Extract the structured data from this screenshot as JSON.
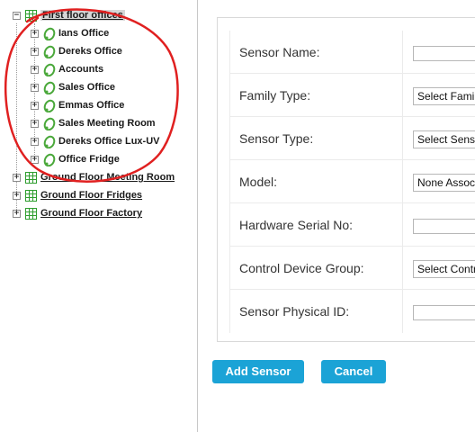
{
  "tree": {
    "root": {
      "label": "First floor offices",
      "expanded": true,
      "toggle": "−"
    },
    "children": [
      {
        "label": "Ians Office",
        "toggle": "+"
      },
      {
        "label": "Dereks Office",
        "toggle": "+"
      },
      {
        "label": "Accounts",
        "toggle": "+"
      },
      {
        "label": "Sales Office",
        "toggle": "+"
      },
      {
        "label": "Emmas Office",
        "toggle": "+"
      },
      {
        "label": "Sales Meeting Room",
        "toggle": "+"
      },
      {
        "label": "Dereks Office Lux-UV",
        "toggle": "+"
      },
      {
        "label": "Office Fridge",
        "toggle": "+"
      }
    ],
    "siblings": [
      {
        "label": "Ground Floor Meeting Room",
        "toggle": "+"
      },
      {
        "label": "Ground Floor Fridges",
        "toggle": "+"
      },
      {
        "label": "Ground Floor Factory",
        "toggle": "+"
      }
    ]
  },
  "form": {
    "sensor_name": {
      "label": "Sensor Name:",
      "value": ""
    },
    "family_type": {
      "label": "Family Type:",
      "selected": "Select Family Type"
    },
    "sensor_type": {
      "label": "Sensor Type:",
      "selected": "Select Sensor Type"
    },
    "model": {
      "label": "Model:",
      "selected": "None Associated"
    },
    "hardware_serial": {
      "label": "Hardware Serial No:",
      "value": ""
    },
    "control_device_group": {
      "label": "Control Device Group:",
      "selected": "Select Control Device Group"
    },
    "sensor_physical_id": {
      "label": "Sensor Physical ID:",
      "value": ""
    }
  },
  "buttons": {
    "add_sensor": "Add Sensor",
    "cancel": "Cancel"
  },
  "colors": {
    "accent": "#1ba3d6",
    "grid_icon": "#2f9e2f",
    "leaf_icon": "#4aa83a",
    "annotation": "#e02020"
  }
}
